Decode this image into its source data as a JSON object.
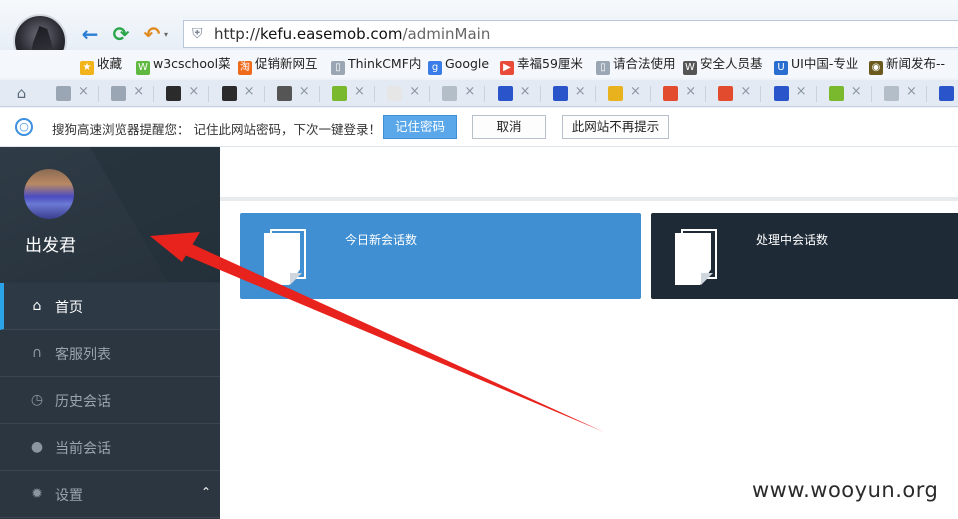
{
  "browser": {
    "url_scheme": "http://",
    "url_domain": "kefu.easemob.com",
    "url_path": "/adminMain",
    "bookmarks": [
      {
        "label": "收藏",
        "icon": "star-icon",
        "color": "#f3b31b"
      },
      {
        "label": "w3cschool菜",
        "icon": "w3c-icon",
        "color": "#5fb83f"
      },
      {
        "label": "促销新网互",
        "icon": "taobao-icon",
        "color": "#f06a1c"
      },
      {
        "label": "ThinkCMF内",
        "icon": "page-icon",
        "color": "#9aa6b3"
      },
      {
        "label": "Google",
        "icon": "google-icon",
        "color": "#3a7de8"
      },
      {
        "label": "幸福59厘米",
        "icon": "play-icon",
        "color": "#e84b3a"
      },
      {
        "label": "请合法使用",
        "icon": "page-icon",
        "color": "#9aa6b3"
      },
      {
        "label": "安全人员基",
        "icon": "wiki-icon",
        "color": "#555555"
      },
      {
        "label": "UI中国-专业",
        "icon": "ui-icon",
        "color": "#2a6fd0"
      },
      {
        "label": "新闻发布--",
        "icon": "news-icon",
        "color": "#6b5a1e"
      }
    ],
    "tabs": [
      {
        "icon": "globe-icon",
        "color": "#9aa6b3"
      },
      {
        "icon": "grid-icon",
        "color": "#9aa6b3"
      },
      {
        "icon": "dark-site-icon",
        "color": "#2b2b2b"
      },
      {
        "icon": "dark-site-icon",
        "color": "#2b2b2b"
      },
      {
        "icon": "star-badge-icon",
        "color": "#555555"
      },
      {
        "icon": "sprout-icon",
        "color": "#7ab82e"
      },
      {
        "icon": "mask-icon",
        "color": "#e6e6e6"
      },
      {
        "icon": "page-icon",
        "color": "#b4bec9"
      },
      {
        "icon": "baidu-paw-icon",
        "color": "#2a54c9"
      },
      {
        "icon": "baidu-paw-icon",
        "color": "#2a54c9"
      },
      {
        "icon": "flag-icon",
        "color": "#e8b21e"
      },
      {
        "icon": "chrome-ring-icon",
        "color": "#e24b2e"
      },
      {
        "icon": "chrome-ring-icon",
        "color": "#e24b2e"
      },
      {
        "icon": "baidu-paw-icon",
        "color": "#2a54c9"
      },
      {
        "icon": "sprout-icon",
        "color": "#7ab82e"
      },
      {
        "icon": "page-icon",
        "color": "#b4bec9"
      },
      {
        "icon": "baidu-paw-icon",
        "color": "#2a54c9"
      }
    ],
    "password_prompt": {
      "message": "搜狗高速浏览器提醒您： 记住此网站密码，下次一键登录！",
      "remember_label": "记住密码",
      "cancel_label": "取消",
      "never_label": "此网站不再提示"
    }
  },
  "sidebar": {
    "user_name": "出发君",
    "menu": [
      {
        "label": "首页",
        "icon": "home-icon",
        "active": true
      },
      {
        "label": "客服列表",
        "icon": "headset-icon",
        "active": false
      },
      {
        "label": "历史会话",
        "icon": "clock-icon",
        "active": false
      },
      {
        "label": "当前会话",
        "icon": "chat-bubble-icon",
        "active": false
      },
      {
        "label": "设置",
        "icon": "gear-icon",
        "active": false
      }
    ]
  },
  "cards": [
    {
      "title": "今日新会话数",
      "color": "#3f8fd2"
    },
    {
      "title": "处理中会话数",
      "color": "#1f2a37"
    }
  ],
  "watermark": "www.wooyun.org",
  "annotation_arrow_color": "#e8221c"
}
